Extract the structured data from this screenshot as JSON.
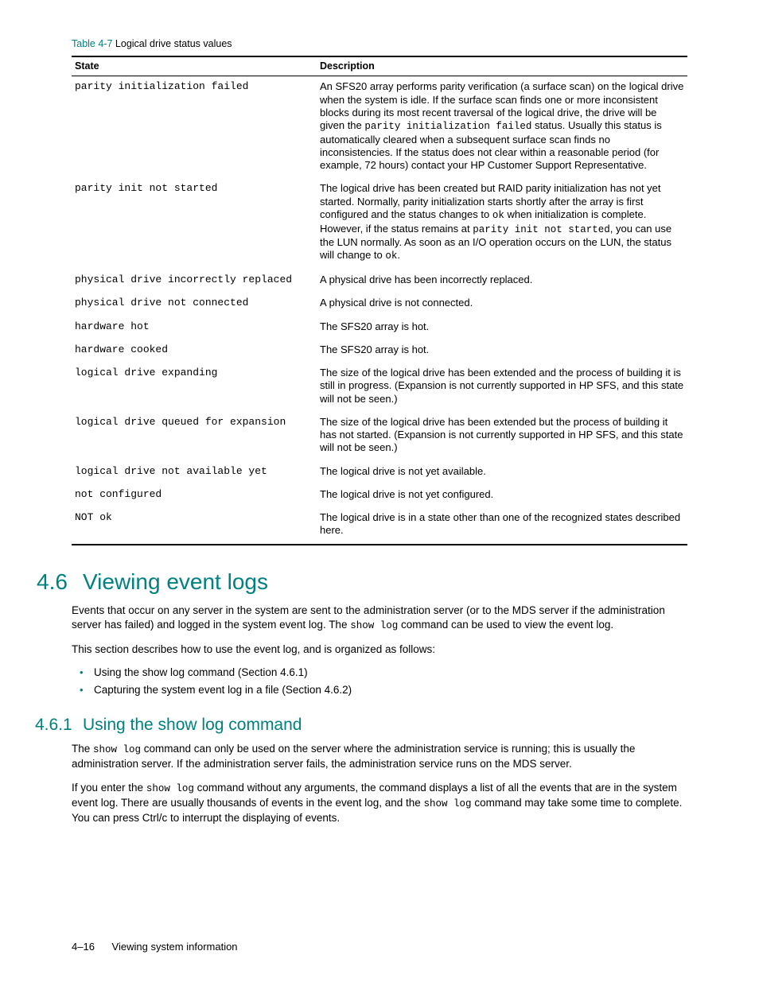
{
  "table": {
    "caption_prefix": "Table 4-7",
    "caption_text": "Logical drive status values",
    "head_state": "State",
    "head_desc": "Description",
    "rows": [
      {
        "state": "parity initialization failed",
        "desc_parts": [
          {
            "t": "An SFS20 array performs parity verification (a surface scan) on the logical drive when the system is idle. If the surface scan finds one or more inconsistent blocks during its most recent traversal of the logical drive, the drive will be given the "
          },
          {
            "t": "parity initialization failed",
            "mono": true
          },
          {
            "t": " status. Usually this status is automatically cleared when a subsequent surface scan finds no inconsistencies. If the status does not clear within a reasonable period (for example, 72 hours) contact your HP Customer Support Representative."
          }
        ]
      },
      {
        "state": "parity init not started",
        "desc_parts": [
          {
            "t": "The logical drive has been created but RAID parity initialization has not yet started. Normally, parity initialization starts shortly after the array is first configured and the status changes to "
          },
          {
            "t": "ok",
            "mono": true
          },
          {
            "t": " when initialization is complete. However, if the status remains at "
          },
          {
            "t": "parity init not started",
            "mono": true
          },
          {
            "t": ", you can use the LUN normally. As soon as an I/O operation occurs on the LUN, the status will change to "
          },
          {
            "t": "ok",
            "mono": true
          },
          {
            "t": "."
          }
        ]
      },
      {
        "state": "physical drive incorrectly replaced",
        "desc_parts": [
          {
            "t": "A physical drive has been incorrectly replaced."
          }
        ]
      },
      {
        "state": "physical drive not connected",
        "desc_parts": [
          {
            "t": "A physical drive is not connected."
          }
        ]
      },
      {
        "state": "hardware hot",
        "desc_parts": [
          {
            "t": "The SFS20 array is hot."
          }
        ]
      },
      {
        "state": "hardware cooked",
        "desc_parts": [
          {
            "t": "The SFS20 array is hot."
          }
        ]
      },
      {
        "state": "logical drive expanding",
        "desc_parts": [
          {
            "t": "The size of the logical drive has been extended and the process of building it is still in progress. (Expansion is not currently supported in HP SFS, and this state will not be seen.)"
          }
        ]
      },
      {
        "state": "logical drive queued for expansion",
        "desc_parts": [
          {
            "t": "The size of the logical drive has been extended but the process of building it has not started. (Expansion is not currently supported in HP SFS, and this state will not be seen.)"
          }
        ]
      },
      {
        "state": "logical drive not available yet",
        "desc_parts": [
          {
            "t": "The logical drive is not yet available."
          }
        ]
      },
      {
        "state": "not configured",
        "desc_parts": [
          {
            "t": "The logical drive is not yet configured."
          }
        ]
      },
      {
        "state": "NOT ok",
        "desc_parts": [
          {
            "t": "The logical drive is in a state other than one of the recognized states described here."
          }
        ]
      }
    ]
  },
  "section46": {
    "num": "4.6",
    "title": "Viewing event logs",
    "p1_parts": [
      {
        "t": "Events that occur on any server in the system are sent to the administration server (or to the MDS server if the administration server has failed) and logged in the system event log. The "
      },
      {
        "t": "show log",
        "mono": true
      },
      {
        "t": " command can be used to view the event log."
      }
    ],
    "p2": "This section describes how to use the event log, and is organized as follows:",
    "bullets": [
      "Using the show log command (Section 4.6.1)",
      "Capturing the system event log in a file (Section 4.6.2)"
    ]
  },
  "section461": {
    "num": "4.6.1",
    "title": "Using the show log command",
    "p1_parts": [
      {
        "t": "The "
      },
      {
        "t": "show log",
        "mono": true
      },
      {
        "t": " command can only be used on the server where the administration service is running; this is usually the administration server. If the administration server fails, the administration service runs on the MDS server."
      }
    ],
    "p2_parts": [
      {
        "t": "If you enter the "
      },
      {
        "t": "show log",
        "mono": true
      },
      {
        "t": " command without any arguments, the command displays a list of all the events that are in the system event log. There are usually thousands of events in the event log, and the "
      },
      {
        "t": "show log",
        "mono": true
      },
      {
        "t": " command may take some time to complete. You can press Ctrl/c to interrupt the displaying of events."
      }
    ]
  },
  "footer": {
    "pagenum": "4–16",
    "section": "Viewing system information"
  }
}
